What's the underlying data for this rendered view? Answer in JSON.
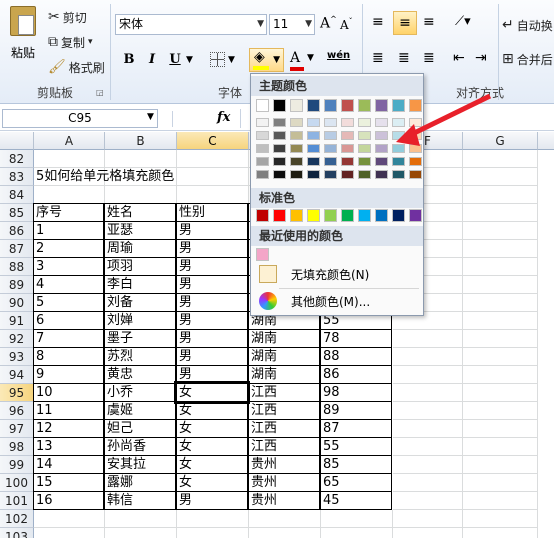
{
  "ribbon": {
    "paste_label": "粘贴",
    "cut_label": "剪切",
    "copy_label": "复制",
    "format_painter_label": "格式刷",
    "clipboard_group": "剪贴板",
    "font_group": "字体",
    "align_group": "对齐方式",
    "font_name": "宋体",
    "font_size": "11",
    "bold": "B",
    "italic": "I",
    "underline": "U",
    "autowrap_label": "自动换",
    "merge_label": "合并后"
  },
  "formula_bar": {
    "name_box": "C95",
    "fx": "fx"
  },
  "sheet": {
    "columns": [
      "A",
      "B",
      "C",
      "D",
      "E",
      "F",
      "G"
    ],
    "rows": [
      {
        "num": "82",
        "cells": [
          "",
          "",
          "",
          "",
          ""
        ]
      },
      {
        "num": "83",
        "cells": [
          "5如何给单元格填充颜色",
          "",
          "",
          "",
          ""
        ]
      },
      {
        "num": "84",
        "cells": [
          "",
          "",
          "",
          "",
          ""
        ]
      },
      {
        "num": "85",
        "cells": [
          "序号",
          "姓名",
          "性别",
          "",
          ""
        ]
      },
      {
        "num": "86",
        "cells": [
          "1",
          "亚瑟",
          "男",
          "",
          ""
        ]
      },
      {
        "num": "87",
        "cells": [
          "2",
          "周瑜",
          "男",
          "",
          ""
        ]
      },
      {
        "num": "88",
        "cells": [
          "3",
          "项羽",
          "男",
          "",
          ""
        ]
      },
      {
        "num": "89",
        "cells": [
          "4",
          "李白",
          "男",
          "",
          ""
        ]
      },
      {
        "num": "90",
        "cells": [
          "5",
          "刘备",
          "男",
          "",
          ""
        ]
      },
      {
        "num": "91",
        "cells": [
          "6",
          "刘婵",
          "男",
          "湖南",
          "55"
        ]
      },
      {
        "num": "92",
        "cells": [
          "7",
          "墨子",
          "男",
          "湖南",
          "78"
        ]
      },
      {
        "num": "93",
        "cells": [
          "8",
          "苏烈",
          "男",
          "湖南",
          "88"
        ]
      },
      {
        "num": "94",
        "cells": [
          "9",
          "黄忠",
          "男",
          "湖南",
          "86"
        ]
      },
      {
        "num": "95",
        "cells": [
          "10",
          "小乔",
          "女",
          "江西",
          "98"
        ]
      },
      {
        "num": "96",
        "cells": [
          "11",
          "虞姬",
          "女",
          "江西",
          "89"
        ]
      },
      {
        "num": "97",
        "cells": [
          "12",
          "妲己",
          "女",
          "江西",
          "87"
        ]
      },
      {
        "num": "98",
        "cells": [
          "13",
          "孙尚香",
          "女",
          "江西",
          "55"
        ]
      },
      {
        "num": "99",
        "cells": [
          "14",
          "安其拉",
          "女",
          "贵州",
          "85"
        ]
      },
      {
        "num": "100",
        "cells": [
          "15",
          "露娜",
          "女",
          "贵州",
          "65"
        ]
      },
      {
        "num": "101",
        "cells": [
          "16",
          "韩信",
          "男",
          "贵州",
          "45"
        ]
      },
      {
        "num": "102",
        "cells": [
          "",
          "",
          "",
          "",
          ""
        ]
      },
      {
        "num": "103",
        "cells": [
          "",
          "",
          "",
          "",
          ""
        ]
      }
    ]
  },
  "palette": {
    "theme_title": "主题颜色",
    "standard_title": "标准色",
    "recent_title": "最近使用的颜色",
    "no_fill_label": "无填充颜色(N)",
    "more_colors_label": "其他颜色(M)...",
    "theme_top": [
      "#ffffff",
      "#000000",
      "#eeece1",
      "#1f497d",
      "#4f81bd",
      "#c0504d",
      "#9bbb59",
      "#8064a2",
      "#4bacc6",
      "#f79646"
    ],
    "theme_shades": [
      [
        "#f2f2f2",
        "#7f7f7f",
        "#ddd9c3",
        "#c6d9f0",
        "#dbe5f1",
        "#f2dcdb",
        "#ebf1dd",
        "#e5e0ec",
        "#dbeef3",
        "#fdeada"
      ],
      [
        "#d8d8d8",
        "#595959",
        "#c4bd97",
        "#8db3e2",
        "#b8cce4",
        "#e5b9b7",
        "#d7e3bc",
        "#ccc1d9",
        "#b7dde8",
        "#fbd5b5"
      ],
      [
        "#bfbfbf",
        "#3f3f3f",
        "#938953",
        "#548dd4",
        "#95b3d7",
        "#d99694",
        "#c3d69b",
        "#b2a2c7",
        "#92cddc",
        "#fac08f"
      ],
      [
        "#a5a5a5",
        "#262626",
        "#494429",
        "#17365d",
        "#366092",
        "#953734",
        "#76923c",
        "#5f497a",
        "#31859b",
        "#e36c09"
      ],
      [
        "#7f7f7f",
        "#0c0c0c",
        "#1d1b10",
        "#0f243e",
        "#244061",
        "#632423",
        "#4f6128",
        "#3f3151",
        "#205867",
        "#974806"
      ]
    ],
    "standard": [
      "#c00000",
      "#ff0000",
      "#ffc000",
      "#ffff00",
      "#92d050",
      "#00b050",
      "#00b0f0",
      "#0070c0",
      "#002060",
      "#7030a0"
    ],
    "recent": [
      "#f4a6c8"
    ]
  },
  "annotation": {
    "arrow_color": "#e8202a"
  }
}
